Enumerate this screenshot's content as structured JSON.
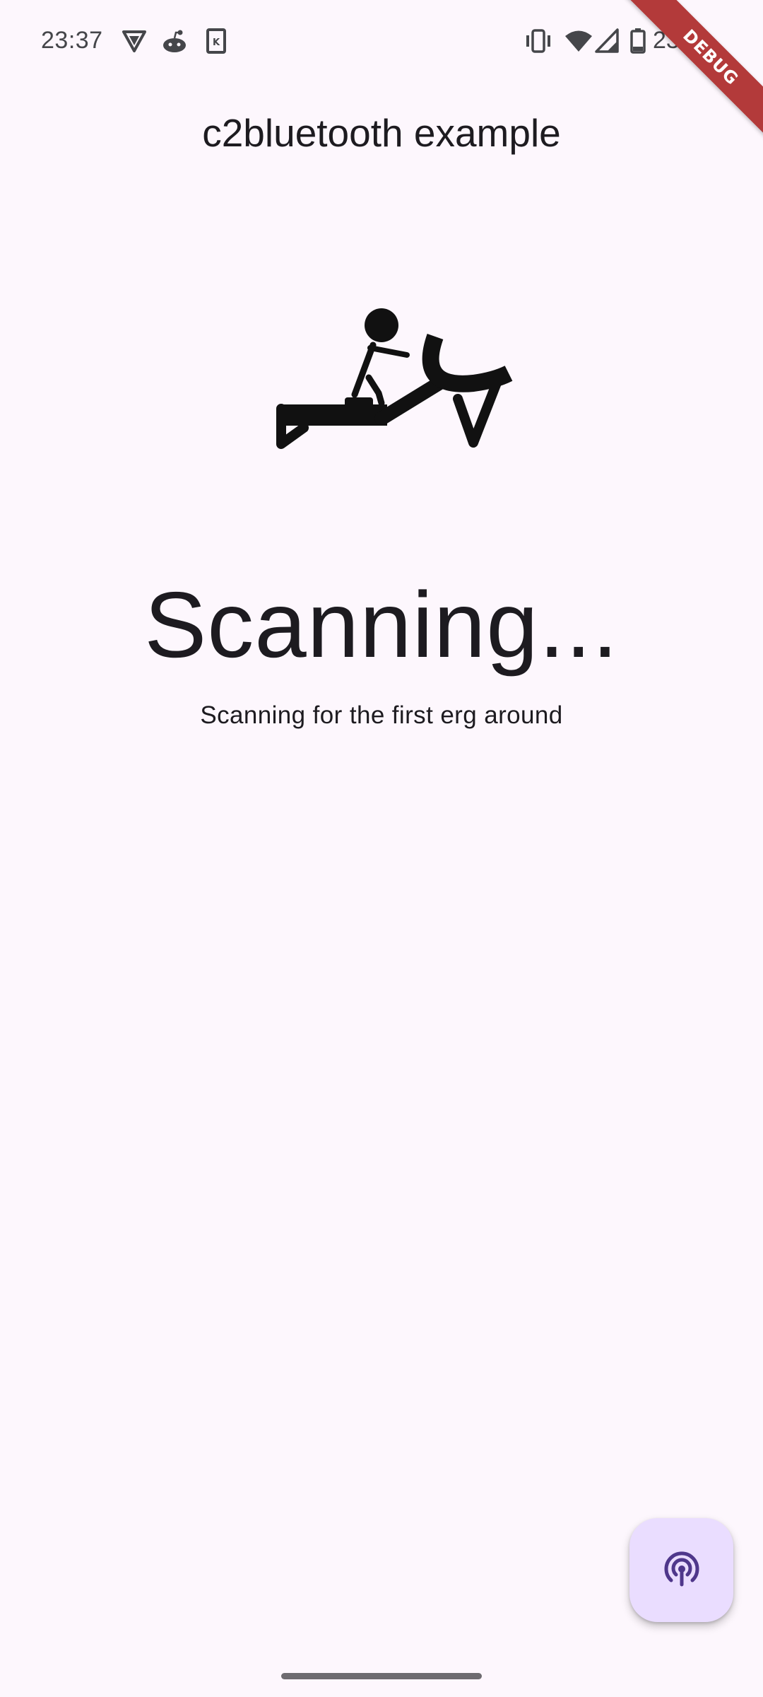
{
  "status_bar": {
    "time": "23:37",
    "battery_percent": "23 %",
    "icons": [
      "shield-notification-icon",
      "reddit-notification-icon",
      "keepass-notification-icon",
      "vibrate-icon",
      "wifi-icon",
      "cell-signal-icon",
      "battery-icon"
    ]
  },
  "debug_banner": {
    "label": "DEBUG"
  },
  "app_bar": {
    "title": "c2bluetooth example"
  },
  "main": {
    "logo_icon": "rowing-machine-icon",
    "title": "Scanning...",
    "subtitle": "Scanning for the first erg around"
  },
  "fab": {
    "icon": "broadcast-scan-icon",
    "color": "#eaddff",
    "icon_color": "#4f378b"
  },
  "colors": {
    "background": "#fdf7fd",
    "text": "#1d1b20",
    "debug_ribbon": "#b33a3a"
  }
}
